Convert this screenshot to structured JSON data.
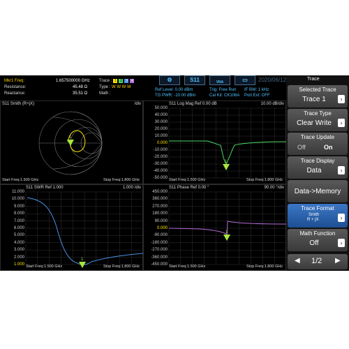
{
  "header": {
    "mkr_freq_label": "Mkr1 Freq:",
    "mkr_freq_value": "1.657500000 GHz",
    "resistance_label": "Resistance:",
    "resistance_value": "45.48 Ω",
    "reactance_label": "Reactance:",
    "reactance_value": "35.51 Ω",
    "trace_label": "Trace :",
    "trace_numbers": [
      "1",
      "2",
      "3",
      "4"
    ],
    "type_label": "Type :",
    "type_values": "W W W W",
    "math_label": "Math :",
    "ref_level": "Ref Level: 0.00 dBm",
    "tg_pwr": "TG PWR: -10.00 dBm",
    "trig": "Trig: Free Run",
    "cal_kit": "Cal Kit: CK106A",
    "if_bw": "IF BW: 1 kHz",
    "port_ext": "Port Ext: OFF",
    "date": "2020/06/12",
    "toolbar_s11": "S11",
    "toolbar_vna": "VNA"
  },
  "panels": {
    "smith": {
      "title": "S11  Smith (R+jX)",
      "scale": "/div",
      "start": "Start Freq:1.500 GHz",
      "stop": "Stop Freq:1.800 GHz"
    },
    "logmag": {
      "title": "S11  Log Mag   Ref 0.00 dB",
      "scale": "10.00  dB/div",
      "start": "Start Freq:1.500 GHz",
      "stop": "Stop Freq:1.800 GHz",
      "yticks": [
        "50.000",
        "40.000",
        "30.000",
        "20.000",
        "10.000",
        "0.000",
        "-10.000",
        "-20.000",
        "-30.000",
        "-40.000",
        "-50.000"
      ]
    },
    "swr": {
      "title": "S11  SWR   Ref 1.000",
      "scale": "1.000  /div",
      "start": "Start Freq:1.500 GHz",
      "stop": "Stop Freq:1.800 GHz",
      "yticks": [
        "11.000",
        "10.000",
        "9.000",
        "8.000",
        "7.000",
        "6.000",
        "5.000",
        "4.000",
        "3.000",
        "2.000",
        "1.000"
      ]
    },
    "phase": {
      "title": "S11  Phase   Ref 0.00 °",
      "scale": "90.00  °/div",
      "start": "Start Freq:1.500 GHz",
      "stop": "Stop Freq:1.800 GHz",
      "yticks": [
        "450.000",
        "360.000",
        "270.000",
        "180.000",
        "90.000",
        "0.000",
        "-90.000",
        "-180.000",
        "-270.000",
        "-360.000",
        "-450.000"
      ]
    }
  },
  "marker_label": "1",
  "menu": {
    "top_label": "Trace",
    "selected_trace_title": "Selected Trace",
    "selected_trace_value": "Trace 1",
    "trace_type_title": "Trace Type",
    "trace_type_value": "Clear Write",
    "trace_update_title": "Trace Update",
    "trace_update_off": "Off",
    "trace_update_on": "On",
    "trace_display_title": "Trace Display",
    "trace_display_value": "Data",
    "data_memory": "Data->Memory",
    "trace_format_title": "Trace Format",
    "trace_format_value1": "Smith",
    "trace_format_value2": "R + jX",
    "math_function_title": "Math Function",
    "math_function_value": "Off",
    "page": "1/2"
  },
  "colors": {
    "trace_yellow": "#ffe600",
    "trace_green": "#4cd964",
    "trace_blue": "#4a90e2",
    "trace_purple": "#b36bd8",
    "marker": "#a8e63c"
  }
}
